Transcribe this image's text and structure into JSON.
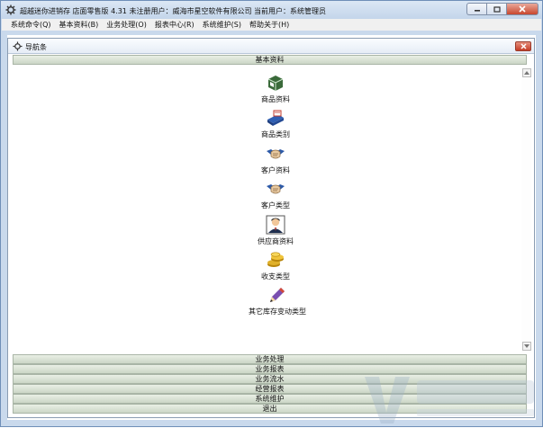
{
  "window": {
    "title": "超越迷你进销存 店面零售版 4.31  未注册用户：威海市星空软件有限公司  当前用户：系统管理员"
  },
  "menubar": {
    "items": [
      {
        "label": "系统命令(Q)"
      },
      {
        "label": "基本资料(B)"
      },
      {
        "label": "业务处理(O)"
      },
      {
        "label": "报表中心(R)"
      },
      {
        "label": "系统维护(S)"
      },
      {
        "label": "帮助关于(H)"
      }
    ]
  },
  "panel": {
    "title": "导航条",
    "active_group": "基本资料",
    "items": [
      {
        "label": "商品资料",
        "icon": "box-icon"
      },
      {
        "label": "商品类别",
        "icon": "category-icon"
      },
      {
        "label": "客户资料",
        "icon": "handshake-icon"
      },
      {
        "label": "客户类型",
        "icon": "handshake-icon"
      },
      {
        "label": "供应商资料",
        "icon": "person-icon"
      },
      {
        "label": "收支类型",
        "icon": "coins-icon"
      },
      {
        "label": "其它库存变动类型",
        "icon": "pen-icon"
      }
    ],
    "bottom_groups": [
      {
        "label": "业务处理"
      },
      {
        "label": "业务报表"
      },
      {
        "label": "业务流水"
      },
      {
        "label": "经营报表"
      },
      {
        "label": "系统维护"
      },
      {
        "label": "退出"
      }
    ]
  },
  "colors": {
    "frame": "#c9d9ec",
    "group_bar": "#d6dfd2",
    "close_red": "#c8472f"
  }
}
